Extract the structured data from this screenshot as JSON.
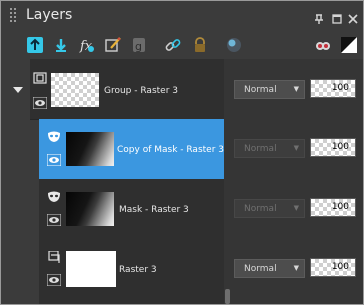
{
  "panel": {
    "title": "Layers"
  },
  "layers": [
    {
      "name": "Group - Raster 3",
      "blend_mode": "Normal",
      "opacity": "100"
    },
    {
      "name": "Copy of Mask - Raster 3",
      "blend_mode": "Normal",
      "opacity": "100"
    },
    {
      "name": "Mask - Raster 3",
      "blend_mode": "Normal",
      "opacity": "100"
    },
    {
      "name": "Raster 3",
      "blend_mode": "Normal",
      "opacity": "100"
    }
  ],
  "colors": {
    "selection": "#3b97e0",
    "panel_bg": "#3b3b3b",
    "accent_cyan": "#35c8e8"
  }
}
